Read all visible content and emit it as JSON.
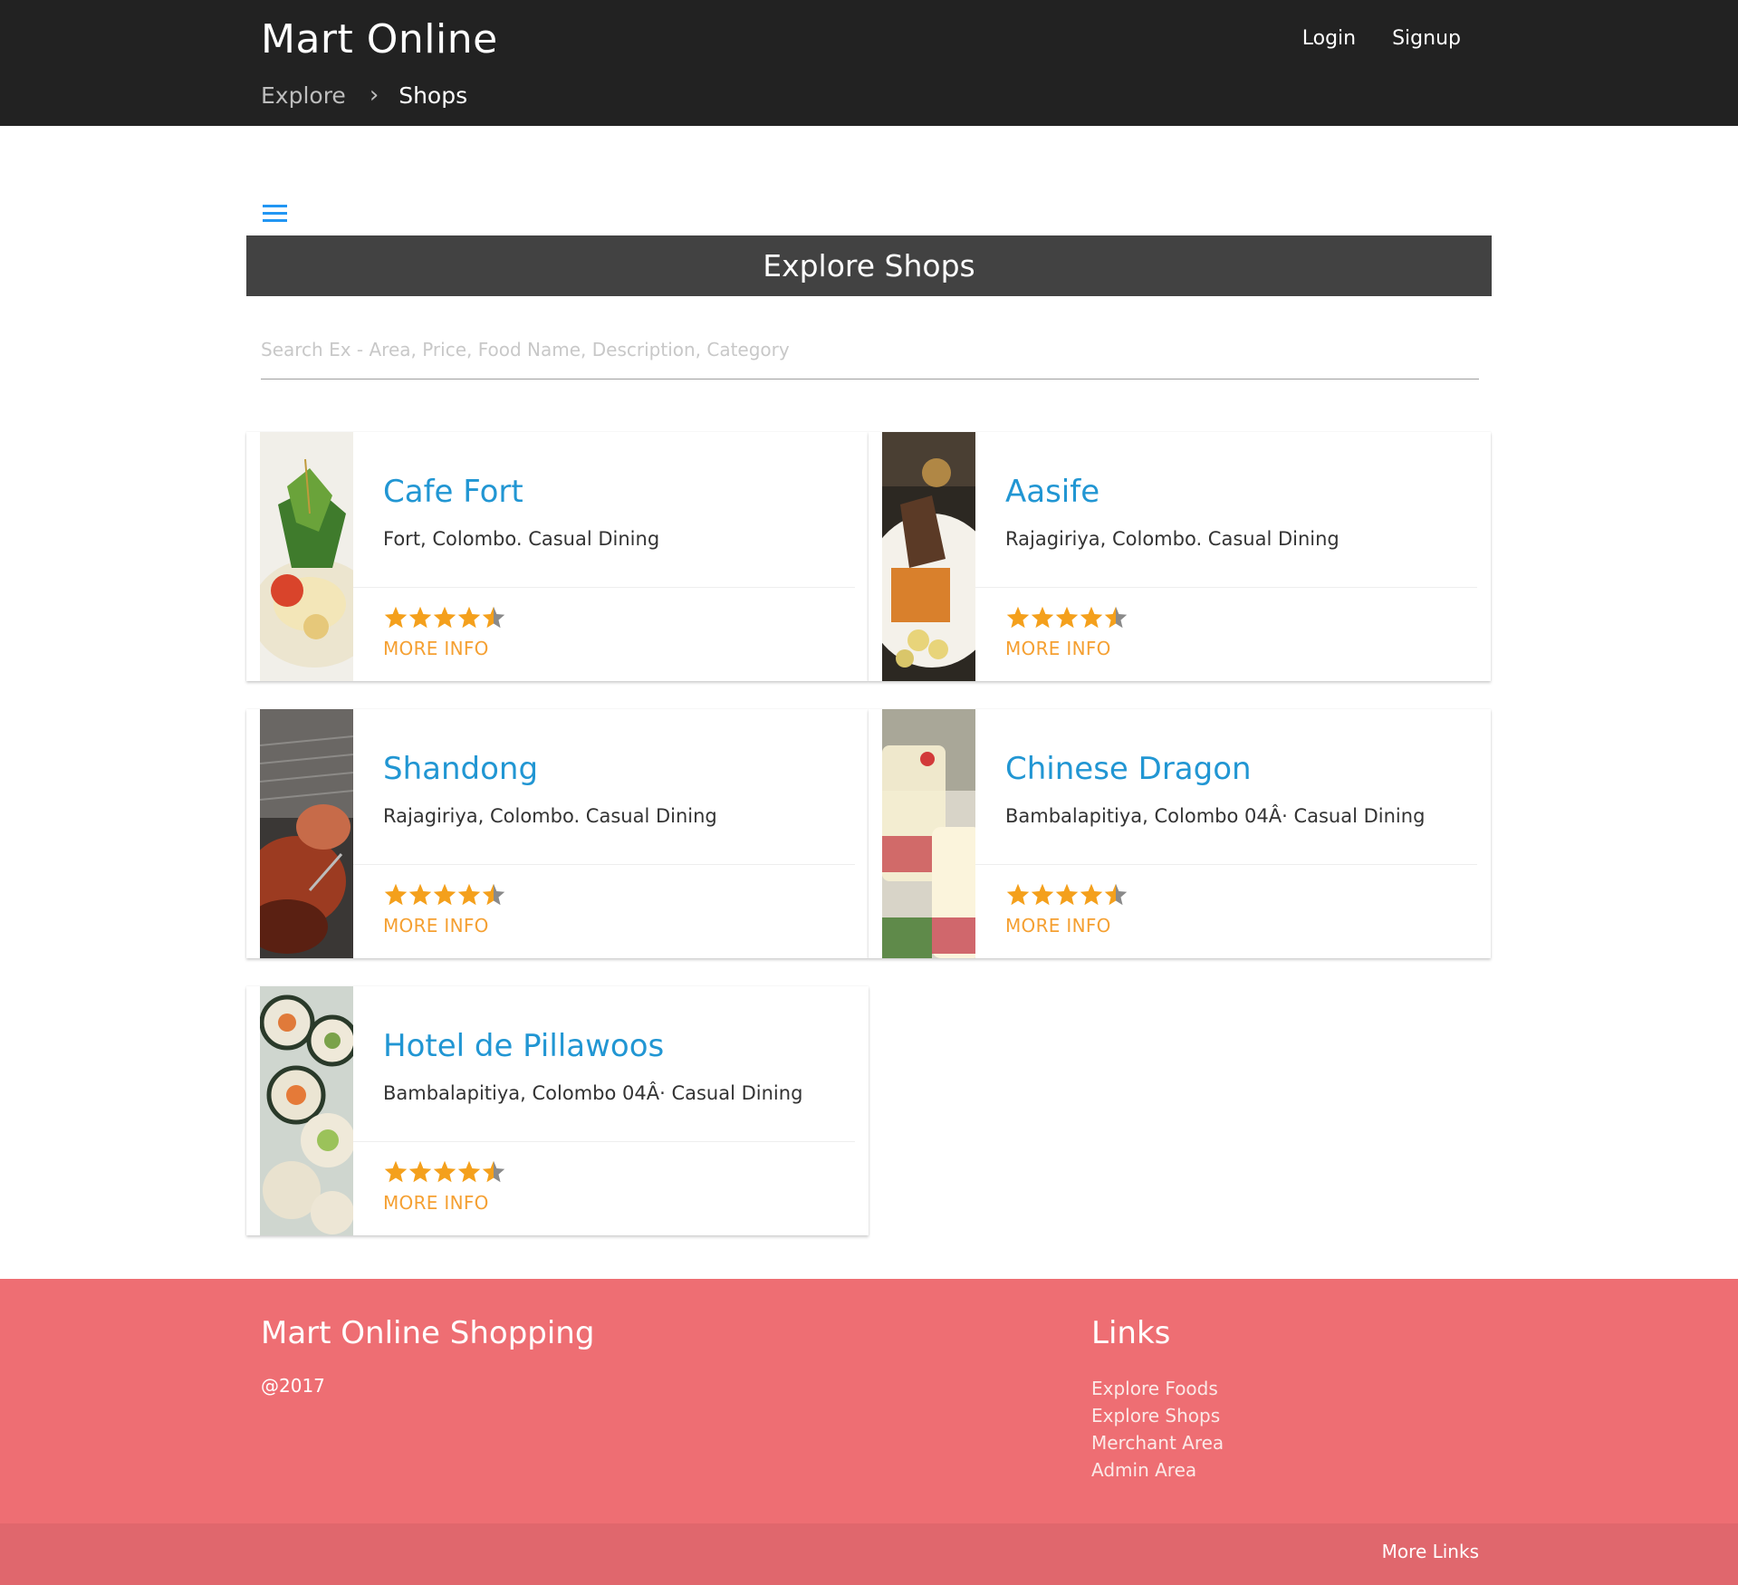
{
  "app": {
    "brand": "Mart Online",
    "nav_links": [
      "Login",
      "Signup"
    ]
  },
  "breadcrumb": {
    "items": [
      "Explore",
      "Shops"
    ],
    "separator": "›"
  },
  "page": {
    "menu_icon": "hamburger-menu-icon",
    "section_title": "Explore Shops",
    "search_placeholder": "Search Ex - Area, Price, Food Name, Description, Category",
    "search_value": ""
  },
  "shops": [
    {
      "name": "Cafe Fort",
      "description": "Fort, Colombo. Casual Dining",
      "rating": 4.5,
      "action_label": "MORE INFO",
      "image": "salad-dish"
    },
    {
      "name": "Aasife",
      "description": "Rajagiriya, Colombo. Casual Dining",
      "rating": 4.5,
      "action_label": "MORE INFO",
      "image": "grilled-fish-plate"
    },
    {
      "name": "Shandong",
      "description": "Rajagiriya, Colombo. Casual Dining",
      "rating": 4.5,
      "action_label": "MORE INFO",
      "image": "grilled-meat"
    },
    {
      "name": "Chinese Dragon",
      "description": "Bambalapitiya, Colombo 04Â· Casual Dining",
      "rating": 4.5,
      "action_label": "MORE INFO",
      "image": "dessert-glasses"
    },
    {
      "name": "Hotel de Pillawoos",
      "description": "Bambalapitiya, Colombo 04Â· Casual Dining",
      "rating": 4.5,
      "action_label": "MORE INFO",
      "image": "sushi-rolls"
    }
  ],
  "footer": {
    "title": "Mart Online Shopping",
    "copyright": "@2017",
    "links_title": "Links",
    "links": [
      "Explore Foods",
      "Explore Shops",
      "Merchant Area",
      "Admin Area"
    ],
    "more_links": "More Links"
  },
  "colors": {
    "navbar": "#222222",
    "section_header": "#424242",
    "accent_blue": "#2196d3",
    "star_orange": "#f4a01c",
    "more_info": "#f5a032",
    "footer": "#ee6e73"
  }
}
